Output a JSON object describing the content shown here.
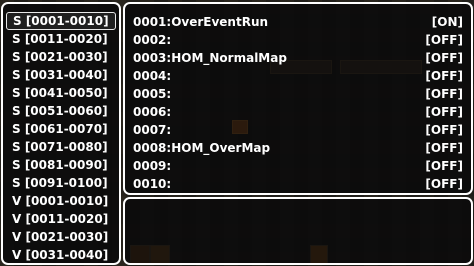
{
  "groups": [
    {
      "label": "S [0001-0010]"
    },
    {
      "label": "S [0011-0020]"
    },
    {
      "label": "S [0021-0030]"
    },
    {
      "label": "S [0031-0040]"
    },
    {
      "label": "S [0041-0050]"
    },
    {
      "label": "S [0051-0060]"
    },
    {
      "label": "S [0061-0070]"
    },
    {
      "label": "S [0071-0080]"
    },
    {
      "label": "S [0081-0090]"
    },
    {
      "label": "S [0091-0100]"
    },
    {
      "label": "V [0001-0010]"
    },
    {
      "label": "V [0011-0020]"
    },
    {
      "label": "V [0021-0030]"
    },
    {
      "label": "V [0031-0040]"
    }
  ],
  "switches": [
    {
      "name": "0001:OverEventRun",
      "state": "[ON]"
    },
    {
      "name": "0002:",
      "state": "[OFF]"
    },
    {
      "name": "0003:HOM_NormalMap",
      "state": "[OFF]"
    },
    {
      "name": "0004:",
      "state": "[OFF]"
    },
    {
      "name": "0005:",
      "state": "[OFF]"
    },
    {
      "name": "0006:",
      "state": "[OFF]"
    },
    {
      "name": "0007:",
      "state": "[OFF]"
    },
    {
      "name": "0008:HOM_OverMap",
      "state": "[OFF]"
    },
    {
      "name": "0009:",
      "state": "[OFF]"
    },
    {
      "name": "0010:",
      "state": "[OFF]"
    }
  ]
}
